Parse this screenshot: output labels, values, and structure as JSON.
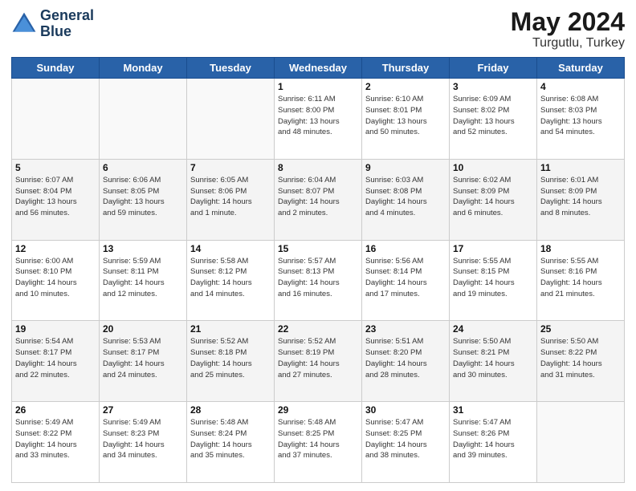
{
  "header": {
    "logo_line1": "General",
    "logo_line2": "Blue",
    "month_year": "May 2024",
    "location": "Turgutlu, Turkey"
  },
  "weekdays": [
    "Sunday",
    "Monday",
    "Tuesday",
    "Wednesday",
    "Thursday",
    "Friday",
    "Saturday"
  ],
  "weeks": [
    [
      {
        "day": "",
        "info": ""
      },
      {
        "day": "",
        "info": ""
      },
      {
        "day": "",
        "info": ""
      },
      {
        "day": "1",
        "info": "Sunrise: 6:11 AM\nSunset: 8:00 PM\nDaylight: 13 hours\nand 48 minutes."
      },
      {
        "day": "2",
        "info": "Sunrise: 6:10 AM\nSunset: 8:01 PM\nDaylight: 13 hours\nand 50 minutes."
      },
      {
        "day": "3",
        "info": "Sunrise: 6:09 AM\nSunset: 8:02 PM\nDaylight: 13 hours\nand 52 minutes."
      },
      {
        "day": "4",
        "info": "Sunrise: 6:08 AM\nSunset: 8:03 PM\nDaylight: 13 hours\nand 54 minutes."
      }
    ],
    [
      {
        "day": "5",
        "info": "Sunrise: 6:07 AM\nSunset: 8:04 PM\nDaylight: 13 hours\nand 56 minutes."
      },
      {
        "day": "6",
        "info": "Sunrise: 6:06 AM\nSunset: 8:05 PM\nDaylight: 13 hours\nand 59 minutes."
      },
      {
        "day": "7",
        "info": "Sunrise: 6:05 AM\nSunset: 8:06 PM\nDaylight: 14 hours\nand 1 minute."
      },
      {
        "day": "8",
        "info": "Sunrise: 6:04 AM\nSunset: 8:07 PM\nDaylight: 14 hours\nand 2 minutes."
      },
      {
        "day": "9",
        "info": "Sunrise: 6:03 AM\nSunset: 8:08 PM\nDaylight: 14 hours\nand 4 minutes."
      },
      {
        "day": "10",
        "info": "Sunrise: 6:02 AM\nSunset: 8:09 PM\nDaylight: 14 hours\nand 6 minutes."
      },
      {
        "day": "11",
        "info": "Sunrise: 6:01 AM\nSunset: 8:09 PM\nDaylight: 14 hours\nand 8 minutes."
      }
    ],
    [
      {
        "day": "12",
        "info": "Sunrise: 6:00 AM\nSunset: 8:10 PM\nDaylight: 14 hours\nand 10 minutes."
      },
      {
        "day": "13",
        "info": "Sunrise: 5:59 AM\nSunset: 8:11 PM\nDaylight: 14 hours\nand 12 minutes."
      },
      {
        "day": "14",
        "info": "Sunrise: 5:58 AM\nSunset: 8:12 PM\nDaylight: 14 hours\nand 14 minutes."
      },
      {
        "day": "15",
        "info": "Sunrise: 5:57 AM\nSunset: 8:13 PM\nDaylight: 14 hours\nand 16 minutes."
      },
      {
        "day": "16",
        "info": "Sunrise: 5:56 AM\nSunset: 8:14 PM\nDaylight: 14 hours\nand 17 minutes."
      },
      {
        "day": "17",
        "info": "Sunrise: 5:55 AM\nSunset: 8:15 PM\nDaylight: 14 hours\nand 19 minutes."
      },
      {
        "day": "18",
        "info": "Sunrise: 5:55 AM\nSunset: 8:16 PM\nDaylight: 14 hours\nand 21 minutes."
      }
    ],
    [
      {
        "day": "19",
        "info": "Sunrise: 5:54 AM\nSunset: 8:17 PM\nDaylight: 14 hours\nand 22 minutes."
      },
      {
        "day": "20",
        "info": "Sunrise: 5:53 AM\nSunset: 8:17 PM\nDaylight: 14 hours\nand 24 minutes."
      },
      {
        "day": "21",
        "info": "Sunrise: 5:52 AM\nSunset: 8:18 PM\nDaylight: 14 hours\nand 25 minutes."
      },
      {
        "day": "22",
        "info": "Sunrise: 5:52 AM\nSunset: 8:19 PM\nDaylight: 14 hours\nand 27 minutes."
      },
      {
        "day": "23",
        "info": "Sunrise: 5:51 AM\nSunset: 8:20 PM\nDaylight: 14 hours\nand 28 minutes."
      },
      {
        "day": "24",
        "info": "Sunrise: 5:50 AM\nSunset: 8:21 PM\nDaylight: 14 hours\nand 30 minutes."
      },
      {
        "day": "25",
        "info": "Sunrise: 5:50 AM\nSunset: 8:22 PM\nDaylight: 14 hours\nand 31 minutes."
      }
    ],
    [
      {
        "day": "26",
        "info": "Sunrise: 5:49 AM\nSunset: 8:22 PM\nDaylight: 14 hours\nand 33 minutes."
      },
      {
        "day": "27",
        "info": "Sunrise: 5:49 AM\nSunset: 8:23 PM\nDaylight: 14 hours\nand 34 minutes."
      },
      {
        "day": "28",
        "info": "Sunrise: 5:48 AM\nSunset: 8:24 PM\nDaylight: 14 hours\nand 35 minutes."
      },
      {
        "day": "29",
        "info": "Sunrise: 5:48 AM\nSunset: 8:25 PM\nDaylight: 14 hours\nand 37 minutes."
      },
      {
        "day": "30",
        "info": "Sunrise: 5:47 AM\nSunset: 8:25 PM\nDaylight: 14 hours\nand 38 minutes."
      },
      {
        "day": "31",
        "info": "Sunrise: 5:47 AM\nSunset: 8:26 PM\nDaylight: 14 hours\nand 39 minutes."
      },
      {
        "day": "",
        "info": ""
      }
    ]
  ]
}
